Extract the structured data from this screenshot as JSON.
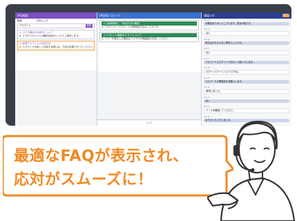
{
  "screens": {
    "faq_list": {
      "header": "FAQ検索",
      "tabs": [
        "検索",
        "お気に入り"
      ],
      "filter": "アカウント",
      "filter_btn": "検索",
      "items": [
        {
          "title": "Q. スマホ解約の手続きについて",
          "body": "A. スマホアカウントの解約手続きについてご案内します。"
        },
        {
          "title": "Q. 新規アカウントの作成方法",
          "body": "A. アカウントを新しく作成する際には、下記の手順で行ってください。"
        }
      ]
    },
    "faq_detail": {
      "header": "FAQ(Q) コメント",
      "items": [
        {
          "title": "Q. 接続環境と、利用方法の確認",
          "body": "A. アカウント・パスワードの再設定方法はこちらです。"
        },
        {
          "title": "Q. ログイン画面のエラーについて",
          "body": "A. エラーが発生した場合はブラウザの再起動をお試しください。"
        }
      ],
      "footer": "1 / 1"
    },
    "chat": {
      "header": "通話ログ",
      "header_btn": "終了",
      "messages": [
        {
          "role": "agent",
          "time": "00:00",
          "text": "お電話ありがとうございます。担当の者です。"
        },
        {
          "role": "cust",
          "time": "00:05",
          "text": "はい"
        },
        {
          "role": "agent",
          "time": "00:09",
          "text": "本日はどのようなご用件でしょうか。"
        },
        {
          "role": "cust",
          "time": "00:15",
          "text": "はい"
        },
        {
          "role": "agent",
          "time": "00:21",
          "text": "アカウントにログインできなくて困っています。"
        },
        {
          "role": "cust",
          "time": "00:28",
          "text": "ログインエラーについてですね。"
        },
        {
          "role": "agent",
          "time": "00:35",
          "text": "パスワードの再設定をお願いします。"
        },
        {
          "role": "cust",
          "time": "00:41",
          "text": "承知しました。"
        },
        {
          "role": "agent",
          "time": "00:47",
          "text": "はい"
        },
        {
          "role": "cust",
          "time": "00:52",
          "text": "メールを確認してください。"
        },
        {
          "role": "agent",
          "time": "00:58",
          "text": "ありがとうございました。"
        }
      ]
    }
  },
  "caption": {
    "line1": "最適なFAQが表示され、",
    "line2": "応対がスムーズに！"
  },
  "colors": {
    "accent": "#f08a24",
    "faq_header": "#7b4fc4",
    "detail_header": "#3b6fd1",
    "chat_header": "#2b3d8f",
    "faq_item": "#2e8b57"
  }
}
